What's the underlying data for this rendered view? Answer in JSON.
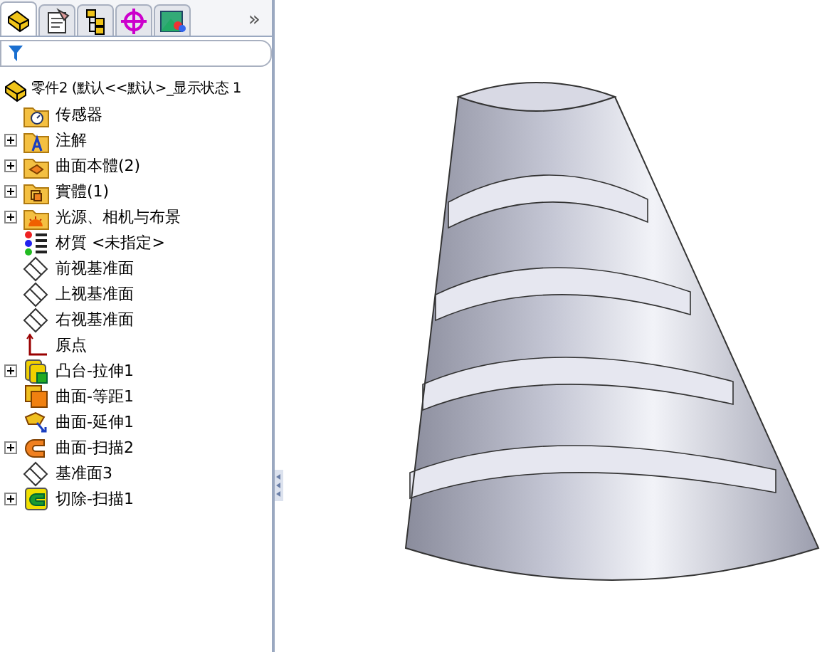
{
  "feature_manager": {
    "tabs": [
      {
        "kind": "feature",
        "selected": true
      },
      {
        "kind": "property",
        "selected": false
      },
      {
        "kind": "config",
        "selected": false
      },
      {
        "kind": "dimxpert",
        "selected": false
      },
      {
        "kind": "display",
        "selected": false
      }
    ],
    "more": "»",
    "tree": {
      "label": "零件2 (默认<<默认>_显示状态 1",
      "kind": "part",
      "children": [
        {
          "label": "传感器",
          "kind": "sensor"
        },
        {
          "label": "注解",
          "kind": "annotation",
          "expanded": false
        },
        {
          "label": "曲面本體(2)",
          "kind": "surface-folder",
          "expanded": false
        },
        {
          "label": "實體(1)",
          "kind": "solid-folder",
          "expanded": false
        },
        {
          "label": "光源、相机与布景",
          "kind": "lights",
          "expanded": false
        },
        {
          "label": "材質 <未指定>",
          "kind": "material"
        },
        {
          "label": "前视基准面",
          "kind": "plane"
        },
        {
          "label": "上视基准面",
          "kind": "plane"
        },
        {
          "label": "右视基准面",
          "kind": "plane"
        },
        {
          "label": "原点",
          "kind": "origin"
        },
        {
          "label": "凸台-拉伸1",
          "kind": "boss",
          "expanded": false
        },
        {
          "label": "曲面-等距1",
          "kind": "offset"
        },
        {
          "label": "曲面-延伸1",
          "kind": "extend"
        },
        {
          "label": "曲面-扫描2",
          "kind": "sweep",
          "expanded": false
        },
        {
          "label": "基准面3",
          "kind": "plane"
        },
        {
          "label": "切除-扫描1",
          "kind": "cut",
          "expanded": false
        }
      ]
    }
  }
}
